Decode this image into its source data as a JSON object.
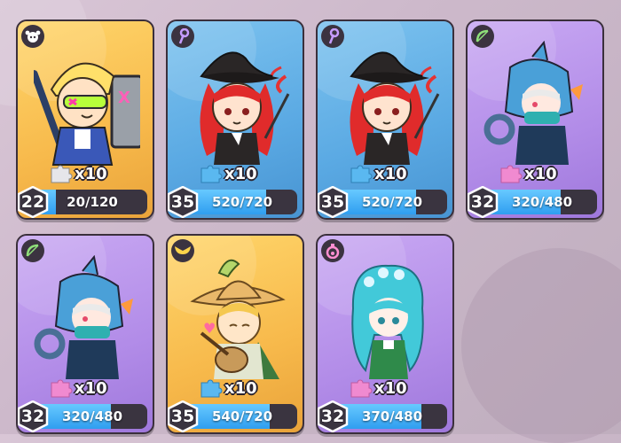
{
  "colors": {
    "gold_card": "#f7b94b",
    "blue_card": "#5aa9e3",
    "purple_card": "#b28ce8",
    "progress_fill": "#2f9ef0",
    "bar_bg": "#3a3440",
    "shard_blue": "#5ab8f0",
    "shard_pink": "#f08ad0"
  },
  "cards": [
    {
      "name": "knight-card",
      "theme": "gold",
      "class_icon": "cow-head-icon",
      "level": "22",
      "shards": "x10",
      "progress": "20/120",
      "progress_fraction": 0.17,
      "shard_color": "gray"
    },
    {
      "name": "witch-card-1",
      "theme": "blue",
      "class_icon": "magic-staff-icon",
      "level": "35",
      "shards": "x10",
      "progress": "520/720",
      "progress_fraction": 0.72,
      "shard_color": "blue"
    },
    {
      "name": "witch-card-2",
      "theme": "blue",
      "class_icon": "magic-staff-icon",
      "level": "35",
      "shards": "x10",
      "progress": "520/720",
      "progress_fraction": 0.72,
      "shard_color": "blue"
    },
    {
      "name": "shark-hood-card-1",
      "theme": "purple",
      "class_icon": "bow-icon",
      "level": "32",
      "shards": "x10",
      "progress": "320/480",
      "progress_fraction": 0.67,
      "shard_color": "pink"
    },
    {
      "name": "shark-hood-card-2",
      "theme": "purple",
      "class_icon": "bow-icon",
      "level": "32",
      "shards": "x10",
      "progress": "320/480",
      "progress_fraction": 0.67,
      "shard_color": "pink"
    },
    {
      "name": "bard-card",
      "theme": "gold",
      "class_icon": "wings-icon",
      "level": "35",
      "shards": "x10",
      "progress": "540/720",
      "progress_fraction": 0.75,
      "shard_color": "blue"
    },
    {
      "name": "mermaid-card",
      "theme": "purple",
      "class_icon": "potion-icon",
      "level": "32",
      "shards": "x10",
      "progress": "370/480",
      "progress_fraction": 0.77,
      "shard_color": "pink"
    }
  ]
}
